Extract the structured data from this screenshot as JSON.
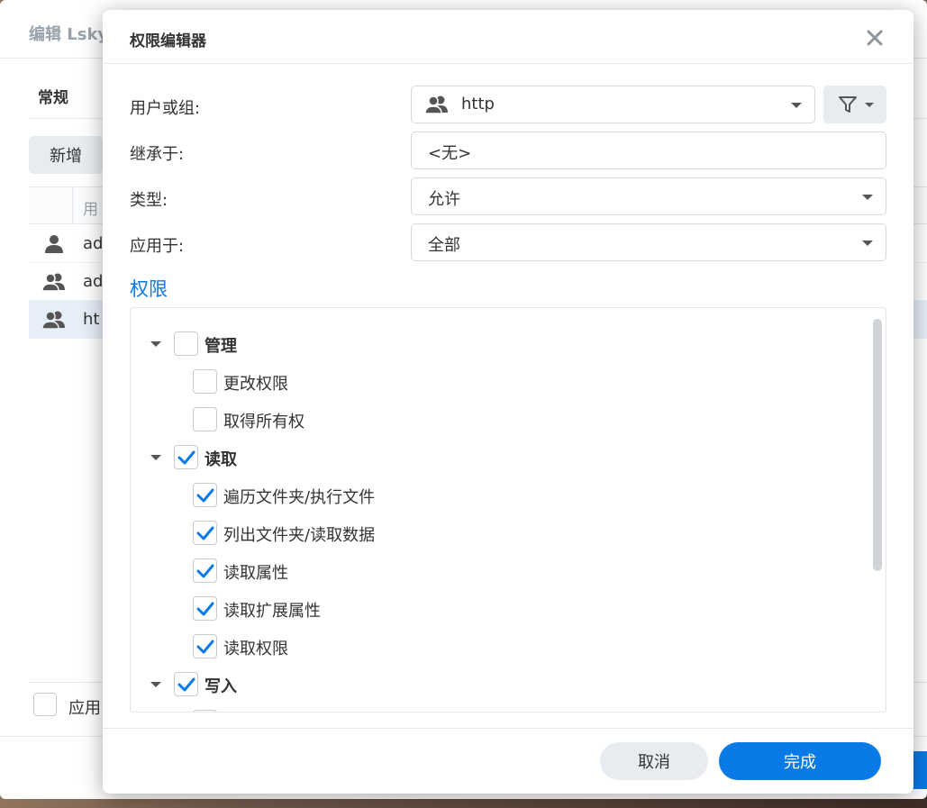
{
  "background_window": {
    "title": "编辑 Lsky",
    "tab_general": "常规",
    "new_button": "新增",
    "column_user": "用",
    "rows": [
      {
        "text": "ad",
        "icon": "user-icon"
      },
      {
        "text": "ad",
        "icon": "group-icon"
      },
      {
        "text": "ht",
        "icon": "group-icon"
      }
    ],
    "apply_label": "应用"
  },
  "dialog": {
    "title": "权限编辑器",
    "close_icon": "close-icon",
    "user_or_group_label": "用户或组:",
    "user_or_group_value": "http",
    "inherit_label": "继承于:",
    "inherit_value": "<无>",
    "type_label": "类型:",
    "type_value": "允许",
    "apply_to_label": "应用于:",
    "apply_to_value": "全部",
    "permissions_title": "权限",
    "filter_icon": "filter-icon",
    "permissions": [
      {
        "label": "管理",
        "level": 0,
        "checked": false,
        "group": true
      },
      {
        "label": "更改权限",
        "level": 1,
        "checked": false,
        "group": false
      },
      {
        "label": "取得所有权",
        "level": 1,
        "checked": false,
        "group": false
      },
      {
        "label": "读取",
        "level": 0,
        "checked": true,
        "group": true
      },
      {
        "label": "遍历文件夹/执行文件",
        "level": 1,
        "checked": true,
        "group": false
      },
      {
        "label": "列出文件夹/读取数据",
        "level": 1,
        "checked": true,
        "group": false
      },
      {
        "label": "读取属性",
        "level": 1,
        "checked": true,
        "group": false
      },
      {
        "label": "读取扩展属性",
        "level": 1,
        "checked": true,
        "group": false
      },
      {
        "label": "读取权限",
        "level": 1,
        "checked": true,
        "group": false
      },
      {
        "label": "写入",
        "level": 0,
        "checked": true,
        "group": true
      }
    ],
    "cancel_label": "取消",
    "done_label": "完成"
  },
  "colors": {
    "accent": "#0a7ae6",
    "check": "#0a7ae6"
  }
}
